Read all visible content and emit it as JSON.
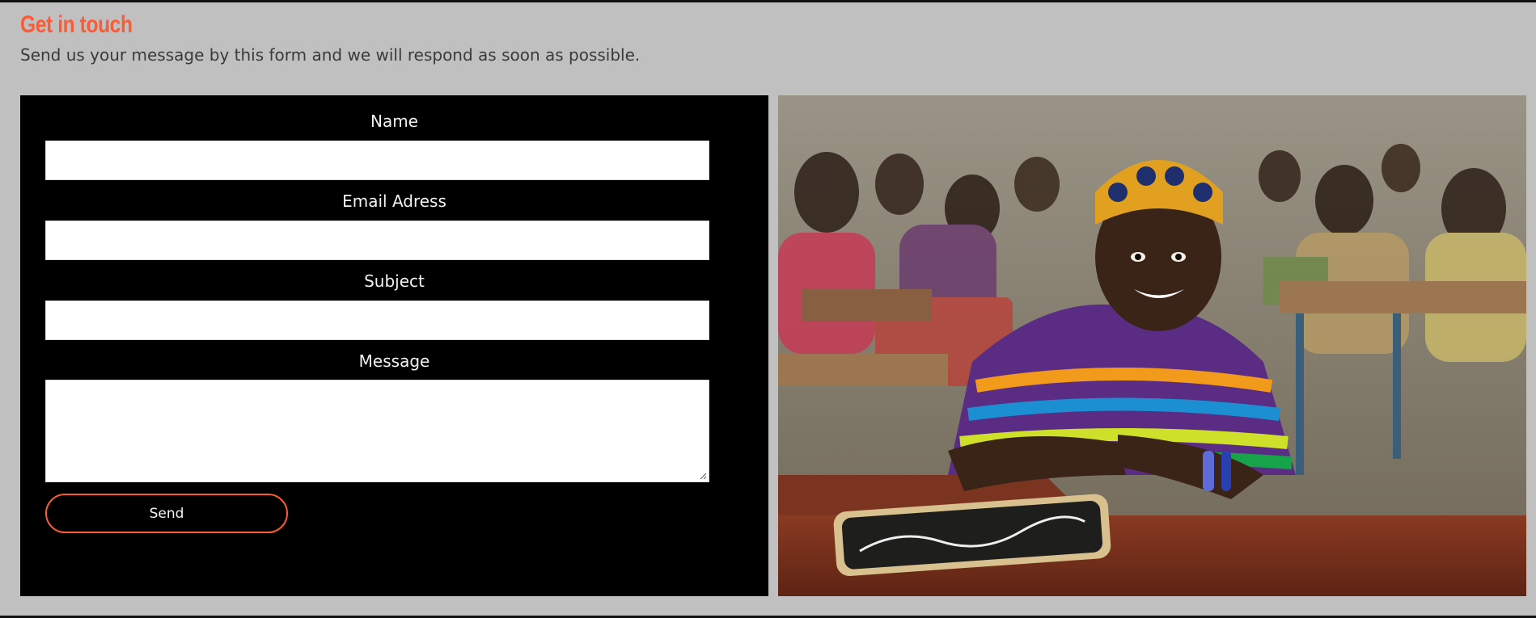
{
  "header": {
    "title": "Get in touch",
    "subtitle": "Send us your message by this form and we will respond as soon as possible."
  },
  "form": {
    "fields": [
      {
        "label": "Name",
        "value": "",
        "placeholder": ""
      },
      {
        "label": "Email Adress",
        "value": "",
        "placeholder": ""
      },
      {
        "label": "Subject",
        "value": "",
        "placeholder": ""
      }
    ],
    "message": {
      "label": "Message",
      "value": "",
      "placeholder": ""
    },
    "send_label": "Send"
  },
  "colors": {
    "accent": "#ff5a36",
    "page_background": "#c0c0c0",
    "form_background": "#000000"
  },
  "photo": {
    "description_icon": "classroom-photo"
  }
}
